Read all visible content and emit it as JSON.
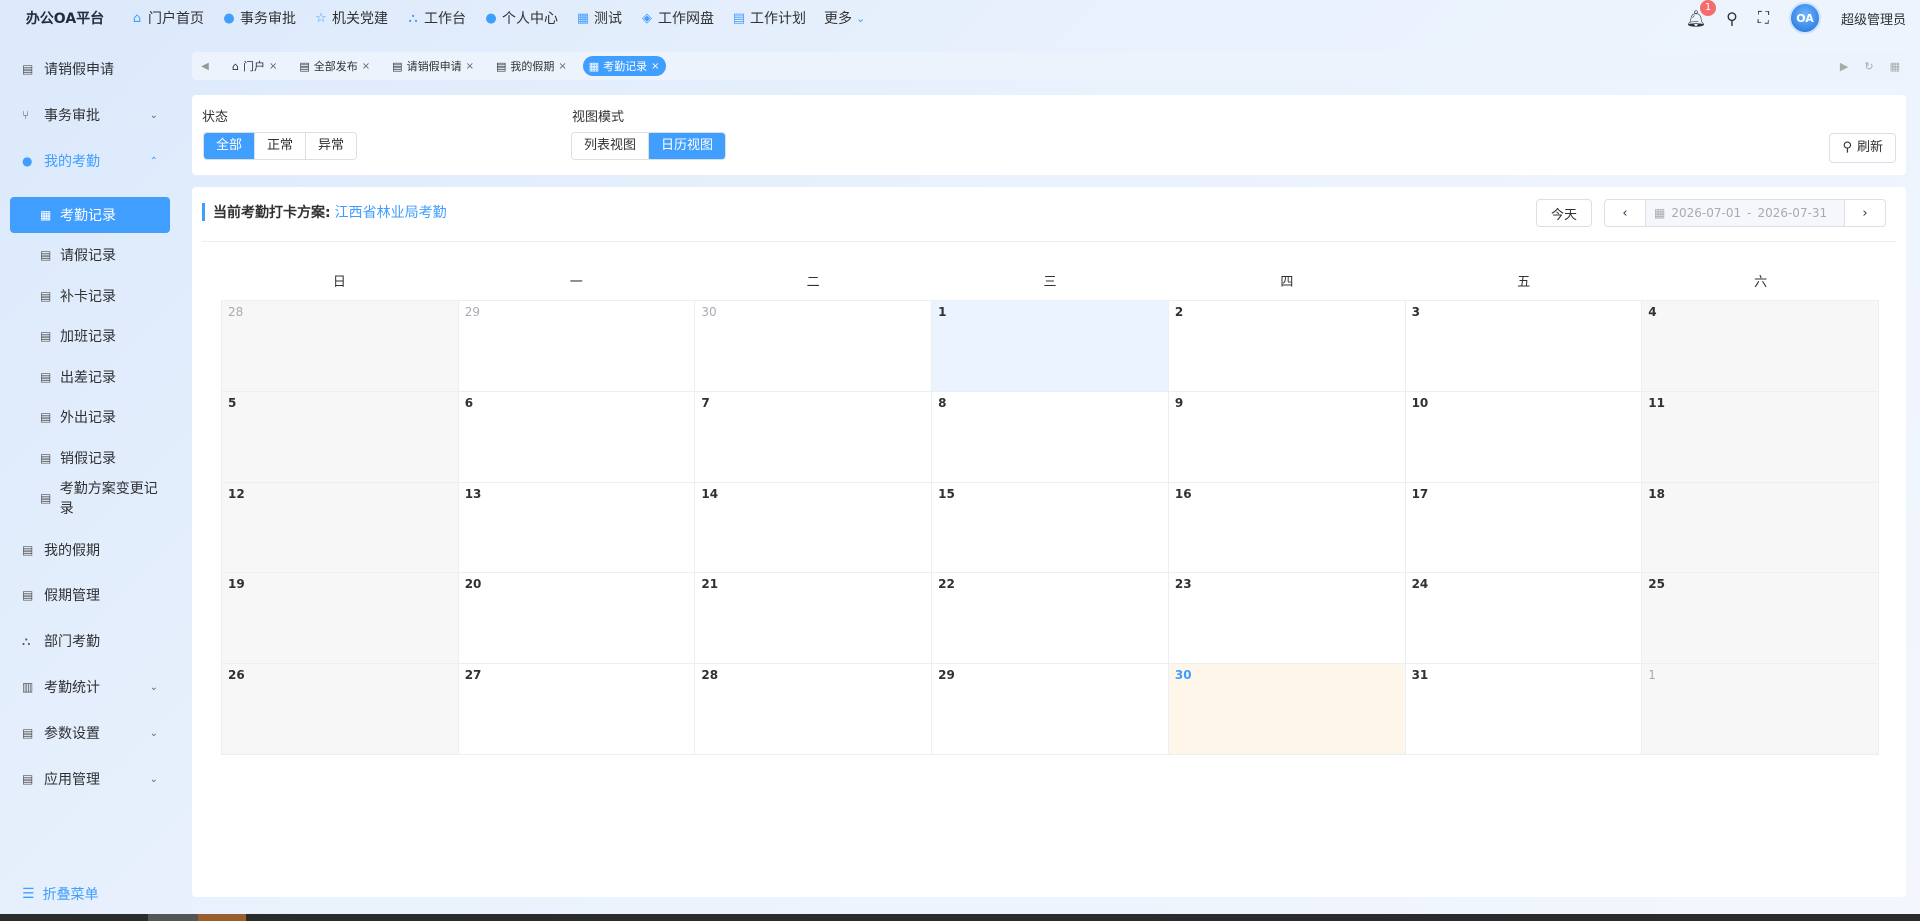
{
  "app": {
    "title": "办公OA平台"
  },
  "topnav": [
    {
      "label": "门户首页",
      "icon": "⌂"
    },
    {
      "label": "事务审批",
      "icon": "●"
    },
    {
      "label": "机关党建",
      "icon": "☆"
    },
    {
      "label": "工作台",
      "icon": "⛬"
    },
    {
      "label": "个人中心",
      "icon": "●"
    },
    {
      "label": "测试",
      "icon": "▦"
    },
    {
      "label": "工作网盘",
      "icon": "◈"
    },
    {
      "label": "工作计划",
      "icon": "▤"
    }
  ],
  "topnav_more": "更多",
  "header": {
    "notification_count": "1",
    "avatar_text": "OA",
    "user_name": "超级管理员"
  },
  "sidebar": {
    "items": [
      {
        "label": "请销假申请"
      },
      {
        "label": "事务审批"
      },
      {
        "label": "我的考勤"
      },
      {
        "label": "我的假期"
      },
      {
        "label": "假期管理"
      },
      {
        "label": "部门考勤"
      },
      {
        "label": "考勤统计"
      },
      {
        "label": "参数设置"
      },
      {
        "label": "应用管理"
      }
    ],
    "subitems": [
      {
        "label": "考勤记录"
      },
      {
        "label": "请假记录"
      },
      {
        "label": "补卡记录"
      },
      {
        "label": "加班记录"
      },
      {
        "label": "出差记录"
      },
      {
        "label": "外出记录"
      },
      {
        "label": "销假记录"
      },
      {
        "label": "考勤方案变更记录"
      }
    ],
    "collapse_label": "折叠菜单"
  },
  "tabs": [
    {
      "label": "门户"
    },
    {
      "label": "全部发布"
    },
    {
      "label": "请销假申请"
    },
    {
      "label": "我的假期"
    },
    {
      "label": "考勤记录"
    }
  ],
  "filters": {
    "status_label": "状态",
    "status_options": [
      "全部",
      "正常",
      "异常"
    ],
    "view_label": "视图模式",
    "view_options": [
      "列表视图",
      "日历视图"
    ],
    "refresh_label": "刷新"
  },
  "calendar": {
    "plan_label": "当前考勤打卡方案:",
    "plan_value": "江西省林业局考勤",
    "today_label": "今天",
    "range_start": "2026-07-01",
    "range_sep": "-",
    "range_end": "2026-07-31",
    "weekdays": [
      "日",
      "一",
      "二",
      "三",
      "四",
      "五",
      "六"
    ],
    "days": [
      "28",
      "29",
      "30",
      "1",
      "2",
      "3",
      "4",
      "5",
      "6",
      "7",
      "8",
      "9",
      "10",
      "11",
      "12",
      "13",
      "14",
      "15",
      "16",
      "17",
      "18",
      "19",
      "20",
      "21",
      "22",
      "23",
      "24",
      "25",
      "26",
      "27",
      "28",
      "29",
      "30",
      "31",
      "1"
    ]
  }
}
